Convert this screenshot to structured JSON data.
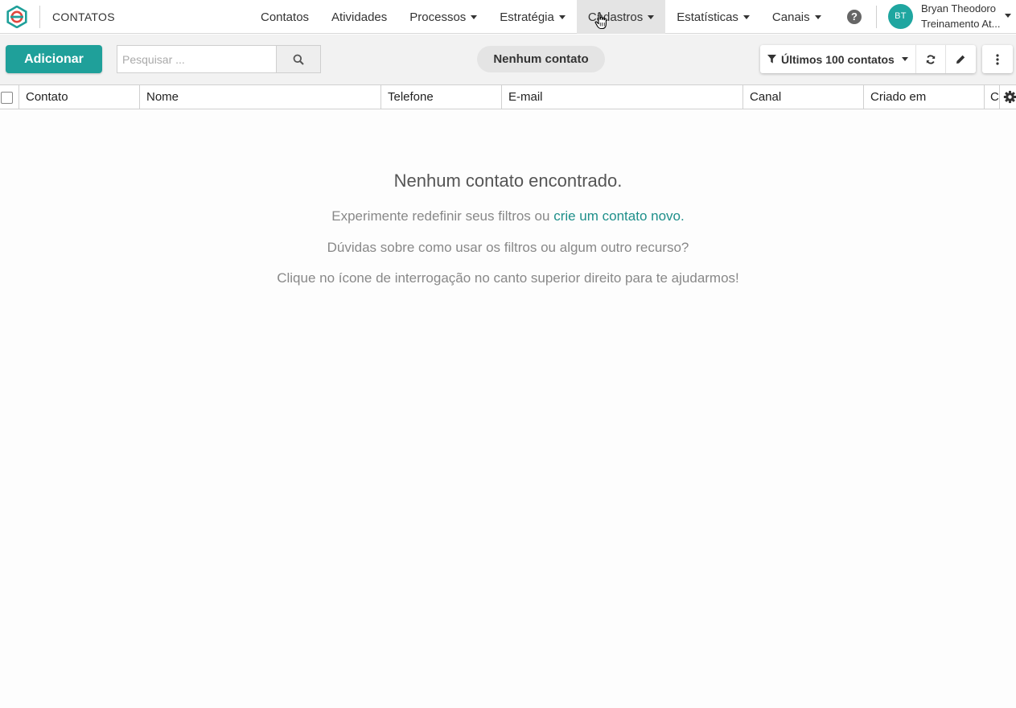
{
  "header": {
    "page_name": "CONTATOS",
    "nav": [
      {
        "label": "Contatos",
        "dropdown": false
      },
      {
        "label": "Atividades",
        "dropdown": false
      },
      {
        "label": "Processos",
        "dropdown": true
      },
      {
        "label": "Estratégia",
        "dropdown": true
      },
      {
        "label": "Cadastros",
        "dropdown": true,
        "active": true
      },
      {
        "label": "Estatísticas",
        "dropdown": true
      },
      {
        "label": "Canais",
        "dropdown": true
      }
    ],
    "help_icon": "question-circle-icon",
    "user": {
      "initials": "BT",
      "name": "Bryan Theodoro",
      "org": "Treinamento At...",
      "avatar_color": "#1fa6a0"
    }
  },
  "toolbar": {
    "add_label": "Adicionar",
    "search_placeholder": "Pesquisar ...",
    "status_pill": "Nenhum contato",
    "filter_label": "Últimos 100 contatos",
    "accent": "#1fa09a"
  },
  "table": {
    "columns": [
      "Contato",
      "Nome",
      "Telefone",
      "E-mail",
      "Canal",
      "Criado em",
      "C"
    ]
  },
  "empty_state": {
    "title": "Nenhum contato encontrado.",
    "line1_text": "Experimente redefinir seus filtros ou",
    "line1_link": "crie um contato novo.",
    "line2": "Dúvidas sobre como usar os filtros ou algum outro recurso?",
    "line3": "Clique no ícone de interrogação no canto superior direito para te ajudarmos!"
  }
}
